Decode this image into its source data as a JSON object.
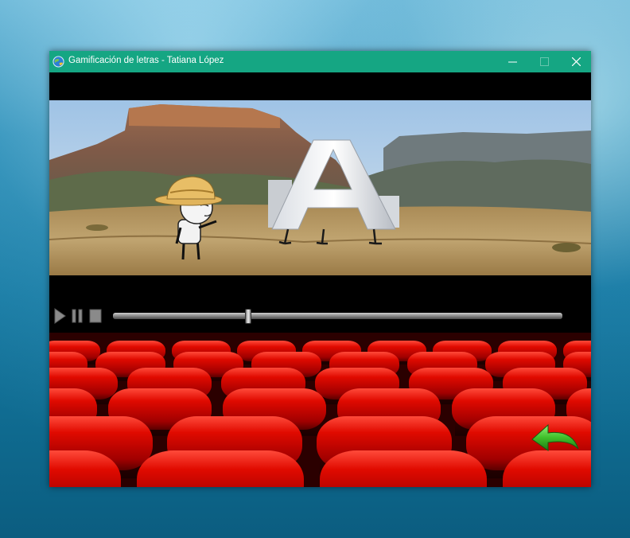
{
  "window": {
    "title": "Gamificación de letras - Tatiana López"
  },
  "titlebar_buttons": {
    "minimize": "—",
    "maximize": "☐",
    "close": "✕"
  },
  "player": {
    "seek_progress": 0.3
  },
  "icons": {
    "app": "globe-icon",
    "play": "play-icon",
    "pause": "pause-icon",
    "stop": "stop-icon",
    "back": "back-arrow-icon"
  },
  "colors": {
    "titlebar": "#15a683",
    "seat_red": "#d40000",
    "back_arrow": "#3fbf2a"
  }
}
